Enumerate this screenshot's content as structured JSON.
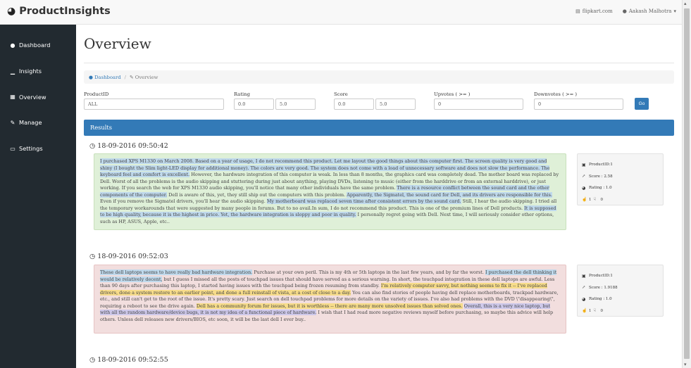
{
  "app": {
    "brand": "ProductInsights",
    "brand_icon": "tachometer-icon"
  },
  "topbar": {
    "link_label": "flipkart.com",
    "user_label": "Aakash Malhotra"
  },
  "sidebar": {
    "items": [
      {
        "label": "Dashboard",
        "icon": "dashboard-icon",
        "glyph": "●"
      },
      {
        "label": "Insights",
        "icon": "bar-chart-icon",
        "glyph": "▁"
      },
      {
        "label": "Overview",
        "icon": "table-icon",
        "glyph": "▦"
      },
      {
        "label": "Manage",
        "icon": "edit-icon",
        "glyph": "✎"
      },
      {
        "label": "Settings",
        "icon": "desktop-icon",
        "glyph": "▭"
      }
    ]
  },
  "page": {
    "title": "Overview",
    "breadcrumb": {
      "home": "Dashboard",
      "current": "Overview"
    }
  },
  "filters": {
    "product_id_label": "ProductID",
    "product_id_value": "ALL",
    "rating_label": "Rating",
    "rating_min": "0.0",
    "rating_max": "5.0",
    "score_label": "Score",
    "score_min": "0.0",
    "score_max": "5.0",
    "upvotes_label": "Upvotes ( >= )",
    "upvotes_value": "0",
    "downvotes_label": "Downvotes ( >= )",
    "downvotes_value": "0",
    "go_label": "Go"
  },
  "results": {
    "header": "Results"
  },
  "reviews": [
    {
      "timestamp": "18-09-2016 09:50:42",
      "segments": [
        {
          "text": "I purchased XPS M1330 on March 2008.  ",
          "hl": "blue"
        },
        {
          "text": "Based on a year of usage, I do not recommend this product.  ",
          "hl": "blue"
        },
        {
          "text": "Let me layout the good things about this computer first.  ",
          "hl": "blue"
        },
        {
          "text": "The screen quality is very good and shiny (I bought the Slim light-LED display for additional money).  ",
          "hl": "blue"
        },
        {
          "text": "The colors are very good.  ",
          "hl": "blue"
        },
        {
          "text": "The system does not come with a load of unnecessary software and does not slow the performance.  ",
          "hl": "blue"
        },
        {
          "text": "The keyboard feel and comfort is excellent.",
          "hl": "blue"
        },
        {
          "text": " However, the hardware integration of this computer is weak. In less than 8 months, the graphics card was completely dead. The mother board was replaced by Dell. Worst of all the problems is the audio skipping and stuttering during just about anything, playing DVDs, listening to music (either from the harddrive or from an external harddrive), or just working. If you search the web for XPS M1330 audio skipping, you'll notice that many other individuals have the same problem.  ",
          "hl": ""
        },
        {
          "text": "There is a resource conflict between the sound card and the other components of the computer.",
          "hl": "blue"
        },
        {
          "text": "  Dell is aware of this, yet, they still ship out the computers with this problem.  ",
          "hl": ""
        },
        {
          "text": "Apparently, the Sigmatel, the sound card for Dell, and its drivers are responsible for this.",
          "hl": "blue"
        },
        {
          "text": "  Even if you remove the Sigmatel drivers, you'll hear the audio skipping.  ",
          "hl": ""
        },
        {
          "text": "My motherboard was replaced seven time after consistent errors by the sound card.",
          "hl": "blue"
        },
        {
          "text": "  Still, I hear the audio skipping. I tried all the temporary workarounds that were suggested by many people in forums. But to no avail.In sum, I do not recommend this product. This is one of the premium lines of Dell products.  ",
          "hl": ""
        },
        {
          "text": "It is supposed to be high quality, because it is the highest in price.  ",
          "hl": "blue"
        },
        {
          "text": "Yet, the hardware integration is sloppy and poor in quality.",
          "hl": "blue"
        },
        {
          "text": "  I personally regret going with Dell. Next time, I will seriously consider other options, such as HP, ASUS, Apple, etc..",
          "hl": ""
        }
      ],
      "color": "green",
      "product_id": "ProductID:1",
      "score": "Score : 2.58",
      "rating": "Rating : 1.0",
      "up": "1",
      "down": "0"
    },
    {
      "timestamp": "18-09-2016 09:52:03",
      "segments": [
        {
          "text": "These dell laptops seems to have really bad hardware integration.",
          "hl": "blue"
        },
        {
          "text": "  Purchase at your own peril. This is my 4th or 5th laptops in the last few years, and by far the worst.  ",
          "hl": ""
        },
        {
          "text": "I purchased the dell thinking it would be relatively decent,",
          "hl": "blue"
        },
        {
          "text": " but I guess I missed all the posts of touchpad issues that should have served as a serious warning.  In short, the touchpad integration in these dell laptops are awful.  Less than 90 days after purchasing this laptop, I started having issues with the touchpad being frozen resuming from standby.  ",
          "hl": ""
        },
        {
          "text": "I'm relatively computer savvy, but nothing seems to fix it -- I've replaced drivers, done a system restore to an earlier point, and done a full reinstall of vista, at a cost of close to a day.",
          "hl": "yellow"
        },
        {
          "text": "  You can also find stories of people having dell replace motherboards, trackpad hardware, etc., and still can't get to the root of the issue. It's pretty scary. Just search on dell touchpad problems for more details on the variety of issues. I've also had problems with the DVD \\\"disappearing\\\", requiring a reboot to see the drive again.  ",
          "hl": ""
        },
        {
          "text": "Dell has a community forum for issues, but it is worthless -- there are many more unsolved issues than solved ones.",
          "hl": "yellow"
        },
        {
          "text": "  ",
          "hl": ""
        },
        {
          "text": "Overall, this is a very nice laptop, but with all the random hardware/device bugs, it is not my idea of a functional piece of hardware.",
          "hl": "purple"
        },
        {
          "text": "  I wish that I had read more negative reviews myself before purchasing, so maybe this advice will help others. Unless dell releases new drivers/BIOS, etc soon, it will be the last dell I ever buy..",
          "hl": ""
        }
      ],
      "color": "red",
      "product_id": "ProductID:1",
      "score": "Score : 1.9188",
      "rating": "Rating : 1.0",
      "up": "1",
      "down": "0"
    },
    {
      "timestamp": "18-09-2016 09:52:55"
    }
  ],
  "colors": {
    "sidebar_bg": "#222a30",
    "primary": "#337ab7",
    "positive_bg": "#dff0d8",
    "negative_bg": "#f2dede",
    "highlight_blue": "#bfd9ec",
    "highlight_yellow": "#f7dc8a",
    "highlight_purple": "#cdc8ea"
  }
}
